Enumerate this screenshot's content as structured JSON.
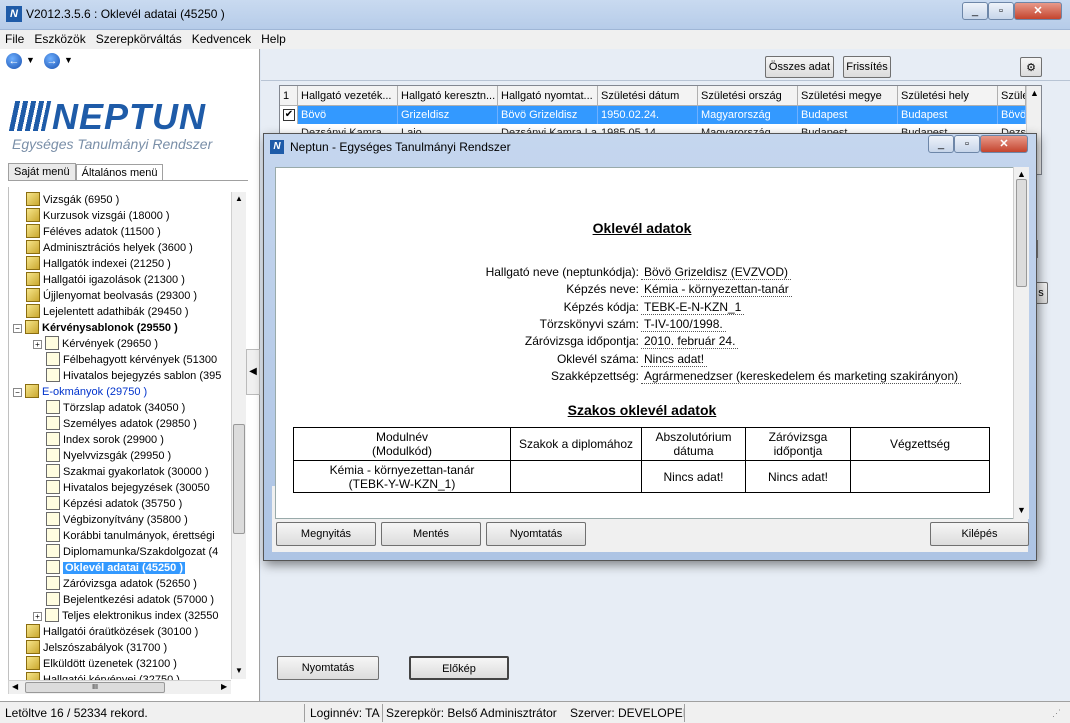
{
  "window": {
    "title": "V2012.3.5.6 : Oklevél adatai (45250  )",
    "icon": "N"
  },
  "menu": [
    "File",
    "Eszközök",
    "Szerepkörváltás",
    "Kedvencek",
    "Help"
  ],
  "logo": {
    "name": "NEPTUN",
    "subtitle": "Egységes Tanulmányi Rendszer"
  },
  "left_tabs": [
    "Saját menü",
    "Általános menü"
  ],
  "tree": [
    {
      "label": "Vizsgák (6950  )",
      "type": "folder",
      "level": 1
    },
    {
      "label": "Kurzusok vizsgái (18000  )",
      "type": "folder",
      "level": 1
    },
    {
      "label": "Féléves adatok (11500  )",
      "type": "folder",
      "level": 1
    },
    {
      "label": "Adminisztrációs helyek (3600  )",
      "type": "folder",
      "level": 1
    },
    {
      "label": "Hallgatók indexei (21250  )",
      "type": "folder",
      "level": 1
    },
    {
      "label": "Hallgatói igazolások (21300  )",
      "type": "folder",
      "level": 1
    },
    {
      "label": "Újjlenyomat beolvasás (29300  )",
      "type": "folder",
      "level": 1
    },
    {
      "label": "Lejelentett adathibák (29450  )",
      "type": "folder",
      "level": 1
    },
    {
      "label": "Kérvénysablonok (29550  )",
      "type": "folder",
      "level": 1,
      "expand": "−",
      "style": "bold"
    },
    {
      "label": "Kérvények (29650  )",
      "type": "doc",
      "level": 2,
      "expand": "+"
    },
    {
      "label": "Félbehagyott kérvények (51300",
      "type": "doc",
      "level": 2
    },
    {
      "label": "Hivatalos bejegyzés sablon (395",
      "type": "doc",
      "level": 2
    },
    {
      "label": "E-okmányok (29750  )",
      "type": "folder",
      "level": 1,
      "expand": "−",
      "style": "blue"
    },
    {
      "label": "Törzslap adatok (34050  )",
      "type": "doc",
      "level": 2
    },
    {
      "label": "Személyes adatok (29850  )",
      "type": "doc",
      "level": 2
    },
    {
      "label": "Index sorok (29900  )",
      "type": "doc",
      "level": 2
    },
    {
      "label": "Nyelvvizsgák (29950  )",
      "type": "doc",
      "level": 2
    },
    {
      "label": "Szakmai gyakorlatok (30000  )",
      "type": "doc",
      "level": 2
    },
    {
      "label": "Hivatalos bejegyzések (30050",
      "type": "doc",
      "level": 2
    },
    {
      "label": "Képzési adatok (35750  )",
      "type": "doc",
      "level": 2
    },
    {
      "label": "Végbizonyítvány (35800  )",
      "type": "doc",
      "level": 2
    },
    {
      "label": "Korábbi tanulmányok, érettségi",
      "type": "doc",
      "level": 2
    },
    {
      "label": "Diplomamunka/Szakdolgozat (4",
      "type": "doc",
      "level": 2
    },
    {
      "label": "Oklevél adatai (45250  )",
      "type": "doc",
      "level": 2,
      "style": "sel"
    },
    {
      "label": "Záróvizsga adatok (52650  )",
      "type": "doc",
      "level": 2
    },
    {
      "label": "Bejelentkezési adatok (57000  )",
      "type": "doc",
      "level": 2
    },
    {
      "label": "Teljes elektronikus index (32550",
      "type": "doc",
      "level": 2,
      "expand": "+"
    },
    {
      "label": "Hallgatói óraütközések (30100  )",
      "type": "folder",
      "level": 1
    },
    {
      "label": "Jelszószabályok (31700  )",
      "type": "folder",
      "level": 1
    },
    {
      "label": "Elküldött üzenetek (32100  )",
      "type": "folder",
      "level": 1
    },
    {
      "label": "Hallgatói kérvényei (32750  )",
      "type": "folder",
      "level": 1
    }
  ],
  "toolbar": {
    "all_data": "Összes adat",
    "refresh": "Frissítés"
  },
  "grid": {
    "index_header": "1",
    "columns": [
      "Hallgató vezeték...",
      "Hallgató keresztn...",
      "Hallgató nyomtat...",
      "Születési dátum",
      "Születési ország",
      "Születési megye",
      "Születési hely",
      "Szüle"
    ],
    "row": [
      "Bövö",
      "Grizeldisz",
      "Bövö Grizeldisz",
      "1950.02.24.",
      "Magyarország",
      "Budapest",
      "Budapest",
      "Bövö"
    ],
    "row2": [
      "Dezsányi Kamra",
      "Lajo",
      "Dezsányi Kamra La",
      "1985.05.14.",
      "Magyarország",
      "Budapest",
      "Budapest",
      "Dezs"
    ]
  },
  "bottom_buttons": {
    "print": "Nyomtatás",
    "preview": "Előkép"
  },
  "status": {
    "records": "Letöltve 16 / 52334 rekord.",
    "login": "Loginnév: TA",
    "role": "Szerepkör: Belső Adminisztrátor",
    "server": "Szerver: DEVELOPEI"
  },
  "dialog": {
    "title": "Neptun - Egységes Tanulmányi Rendszer",
    "heading": "Oklevél adatok",
    "fields": [
      {
        "label": "Hallgató neve (neptunkódja):",
        "value": "Bövö Grizeldisz (EVZVOD)"
      },
      {
        "label": "Képzés neve:",
        "value": "Kémia - környezettan-tanár"
      },
      {
        "label": "Képzés kódja:",
        "value": "TEBK-E-N-KZN_1"
      },
      {
        "label": "Törzskönyvi szám:",
        "value": "T-IV-100/1998."
      },
      {
        "label": "Záróvizsga időpontja:",
        "value": "2010. február 24."
      },
      {
        "label": "Oklevél száma:",
        "value": "Nincs adat!"
      },
      {
        "label": "Szakképzettség:",
        "value": "Agrármenedzser (kereskedelem és marketing szakirányon)"
      }
    ],
    "heading2": "Szakos oklevél adatok",
    "table": {
      "headers": [
        "Modulnév\n(Modulkód)",
        "Szakok a diplomához",
        "Abszolutórium\ndátuma",
        "Záróvizsga\nidőpontja",
        "Végzettség"
      ],
      "row": [
        "Kémia - környezettan-tanár\n(TEBK-Y-W-KZN_1)",
        "",
        "Nincs adat!",
        "Nincs adat!",
        ""
      ]
    },
    "buttons": {
      "open": "Megnyitás",
      "save": "Mentés",
      "print": "Nyomtatás",
      "exit": "Kilépés"
    }
  }
}
